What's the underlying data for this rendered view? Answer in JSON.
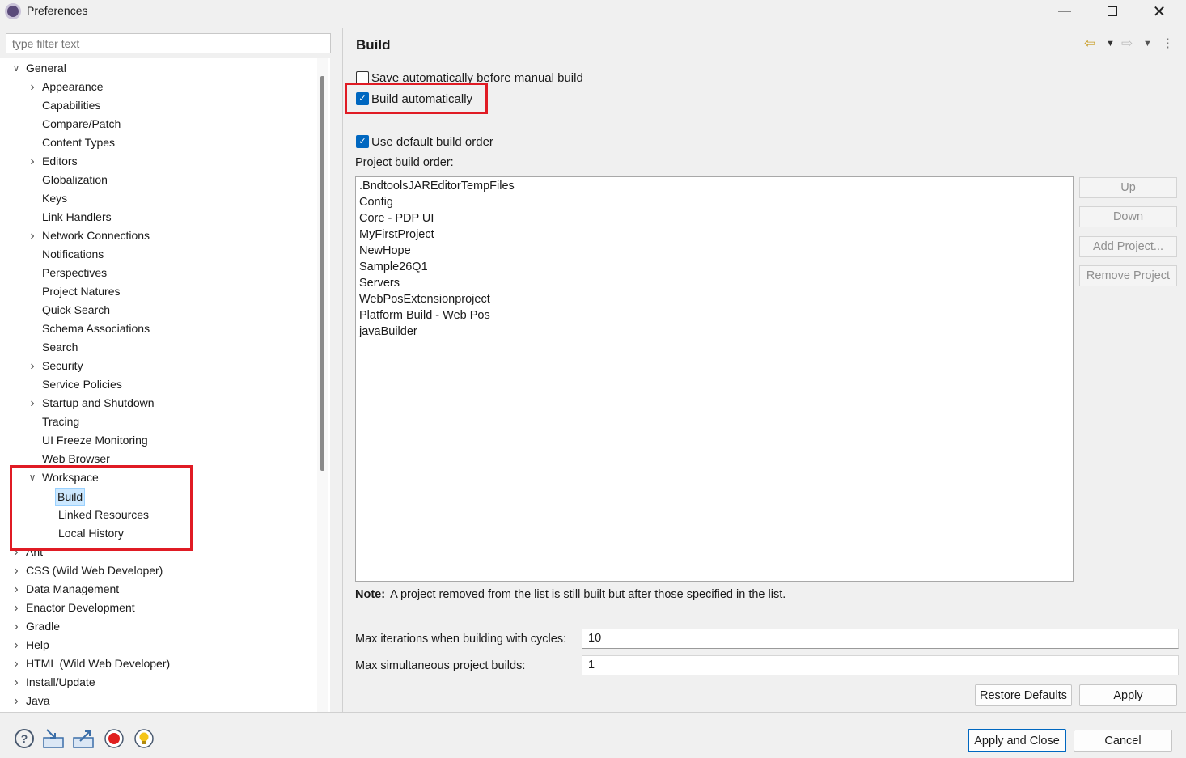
{
  "window": {
    "title": "Preferences",
    "minimize_icon": "minimize-icon",
    "maximize_icon": "maximize-icon",
    "close_icon": "close-icon"
  },
  "filter": {
    "placeholder": "type filter text"
  },
  "tree": {
    "general": "General",
    "items": [
      {
        "label": "Appearance",
        "expandable": true
      },
      {
        "label": "Capabilities",
        "expandable": false
      },
      {
        "label": "Compare/Patch",
        "expandable": false
      },
      {
        "label": "Content Types",
        "expandable": false
      },
      {
        "label": "Editors",
        "expandable": true
      },
      {
        "label": "Globalization",
        "expandable": false
      },
      {
        "label": "Keys",
        "expandable": false
      },
      {
        "label": "Link Handlers",
        "expandable": false
      },
      {
        "label": "Network Connections",
        "expandable": true
      },
      {
        "label": "Notifications",
        "expandable": false
      },
      {
        "label": "Perspectives",
        "expandable": false
      },
      {
        "label": "Project Natures",
        "expandable": false
      },
      {
        "label": "Quick Search",
        "expandable": false
      },
      {
        "label": "Schema Associations",
        "expandable": false
      },
      {
        "label": "Search",
        "expandable": false
      },
      {
        "label": "Security",
        "expandable": true
      },
      {
        "label": "Service Policies",
        "expandable": false
      },
      {
        "label": "Startup and Shutdown",
        "expandable": true
      },
      {
        "label": "Tracing",
        "expandable": false
      },
      {
        "label": "UI Freeze Monitoring",
        "expandable": false
      },
      {
        "label": "Web Browser",
        "expandable": false
      }
    ],
    "workspace": "Workspace",
    "workspace_children": [
      "Build",
      "Linked Resources",
      "Local History"
    ],
    "top_level": [
      "Ant",
      "CSS (Wild Web Developer)",
      "Data Management",
      "Enactor Development",
      "Gradle",
      "Help",
      "HTML (Wild Web Developer)",
      "Install/Update",
      "Java"
    ]
  },
  "page": {
    "title": "Build",
    "back_icon": "back-arrow-icon",
    "forward_icon": "forward-arrow-icon",
    "menu_icon": "vertical-dots-icon",
    "save_before_build": {
      "label": "Save automatically before manual build",
      "checked": false
    },
    "build_automatically": {
      "label": "Build automatically",
      "checked": true
    },
    "use_default_order": {
      "label": "Use default build order",
      "checked": true
    },
    "project_order_label": "Project build order:",
    "projects": [
      ".BndtoolsJAREditorTempFiles",
      "Config",
      "Core - PDP UI",
      "MyFirstProject",
      "NewHope",
      "Sample26Q1",
      "Servers",
      "WebPosExtensionproject",
      "Platform Build - Web Pos",
      "javaBuilder"
    ],
    "buttons": {
      "up": "Up",
      "down": "Down",
      "add_project": "Add Project...",
      "remove_project": "Remove Project"
    },
    "note_bold": "Note:",
    "note_text": "A project removed from the list is still built but after those specified in the list.",
    "max_iterations_label": "Max iterations when building with cycles:",
    "max_iterations_value": "10",
    "max_simultaneous_label": "Max simultaneous project builds:",
    "max_simultaneous_value": "1",
    "restore_defaults": "Restore Defaults",
    "apply": "Apply"
  },
  "footer": {
    "apply_and_close": "Apply and Close",
    "cancel": "Cancel",
    "icons": [
      "help-icon",
      "import-icon",
      "export-icon",
      "record-icon",
      "lightbulb-icon"
    ]
  },
  "colors": {
    "accent": "#0067c0",
    "highlight_box": "#e01b24",
    "selection": "#cce8ff"
  }
}
